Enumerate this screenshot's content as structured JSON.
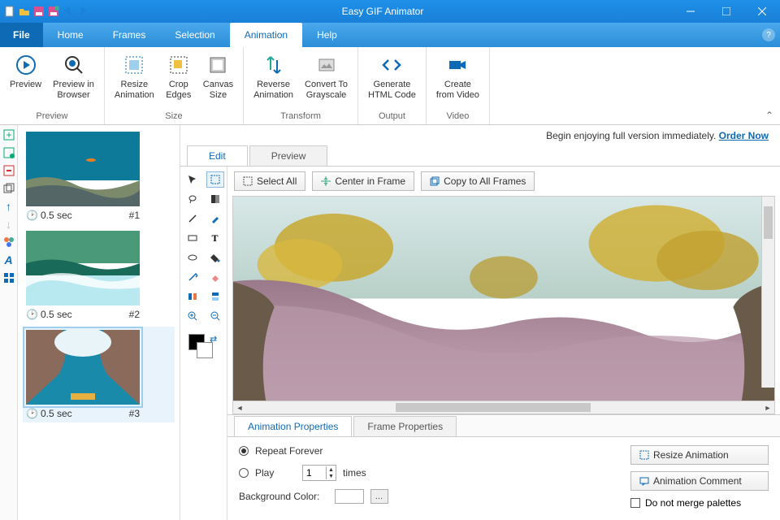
{
  "title": "Easy GIF Animator",
  "tabs": {
    "file": "File",
    "home": "Home",
    "frames": "Frames",
    "selection": "Selection",
    "animation": "Animation",
    "help": "Help"
  },
  "ribbon": {
    "preview": {
      "name": "Preview",
      "btn_preview": "Preview",
      "btn_browser": "Preview in\nBrowser"
    },
    "size": {
      "name": "Size",
      "btn_resize": "Resize\nAnimation",
      "btn_crop": "Crop\nEdges",
      "btn_canvas": "Canvas\nSize"
    },
    "transform": {
      "name": "Transform",
      "btn_reverse": "Reverse\nAnimation",
      "btn_gray": "Convert To\nGrayscale"
    },
    "output": {
      "name": "Output",
      "btn_html": "Generate\nHTML Code"
    },
    "video": {
      "name": "Video",
      "btn_video": "Create\nfrom Video"
    }
  },
  "promo": {
    "text": "Begin enjoying full version immediately. ",
    "link": "Order Now"
  },
  "editTabs": {
    "edit": "Edit",
    "preview": "Preview"
  },
  "actions": {
    "selectAll": "Select All",
    "center": "Center in Frame",
    "copyAll": "Copy to All Frames"
  },
  "frames": [
    {
      "duration": "0.5 sec",
      "num": "#1"
    },
    {
      "duration": "0.5 sec",
      "num": "#2"
    },
    {
      "duration": "0.5 sec",
      "num": "#3"
    }
  ],
  "propsTabs": {
    "anim": "Animation Properties",
    "frame": "Frame Properties"
  },
  "props": {
    "repeat": "Repeat Forever",
    "play": "Play",
    "playValue": "1",
    "times": "times",
    "bgcolor": "Background Color:",
    "resize": "Resize Animation",
    "comment": "Animation Comment",
    "nomerge": "Do not merge palettes"
  }
}
